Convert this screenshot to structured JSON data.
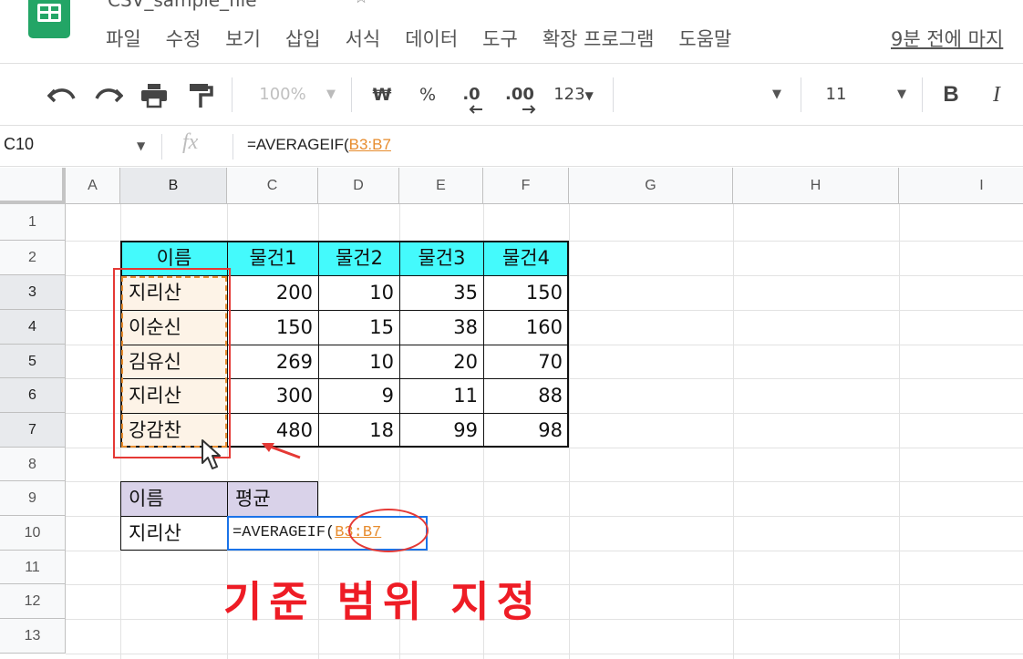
{
  "app": {
    "doc_title": "CSV_sample_file",
    "last_edit": "9분 전에 마지"
  },
  "menu": [
    "파일",
    "수정",
    "보기",
    "삽입",
    "서식",
    "데이터",
    "도구",
    "확장 프로그램",
    "도움말"
  ],
  "toolbar": {
    "zoom": "100%",
    "currency": "₩",
    "percent": "%",
    "decimal_decrease": ".0",
    "decimal_increase": ".00",
    "more_formats": "123",
    "font_size": "11",
    "bold": "B",
    "italic": "I"
  },
  "formula_bar": {
    "name_box": "C10",
    "fx": "fx",
    "formula_prefix": "=AVERAGEIF(",
    "formula_ref": "B3:B7"
  },
  "grid": {
    "columns": [
      "A",
      "B",
      "C",
      "D",
      "E",
      "F",
      "G",
      "H",
      "I"
    ],
    "rows": [
      "1",
      "2",
      "3",
      "4",
      "5",
      "6",
      "7",
      "8",
      "9",
      "10",
      "11",
      "12",
      "13"
    ],
    "selected_column": "B",
    "selected_rows": [
      "3",
      "4",
      "5",
      "6",
      "7"
    ]
  },
  "table": {
    "headers": [
      "이름",
      "물건1",
      "물건2",
      "물건3",
      "물건4"
    ],
    "rows": [
      [
        "지리산",
        "200",
        "10",
        "35",
        "150"
      ],
      [
        "이순신",
        "150",
        "15",
        "38",
        "160"
      ],
      [
        "김유신",
        "269",
        "10",
        "20",
        "70"
      ],
      [
        "지리산",
        "300",
        "9",
        "11",
        "88"
      ],
      [
        "강감찬",
        "480",
        "18",
        "99",
        "98"
      ]
    ]
  },
  "avg_table": {
    "headers": [
      "이름",
      "평균"
    ],
    "name_value": "지리산",
    "formula_prefix": "=AVERAGEIF(",
    "formula_ref": "B3:B7"
  },
  "annotation": "기준 범위 지정",
  "colors": {
    "header_fill": "#44fafc",
    "name_fill": "#fdf3e7",
    "avg_header_fill": "#d9d2e9",
    "range_ref": "#e78c2e",
    "annotation": "#ee1c25",
    "active_border": "#1a73e8"
  }
}
